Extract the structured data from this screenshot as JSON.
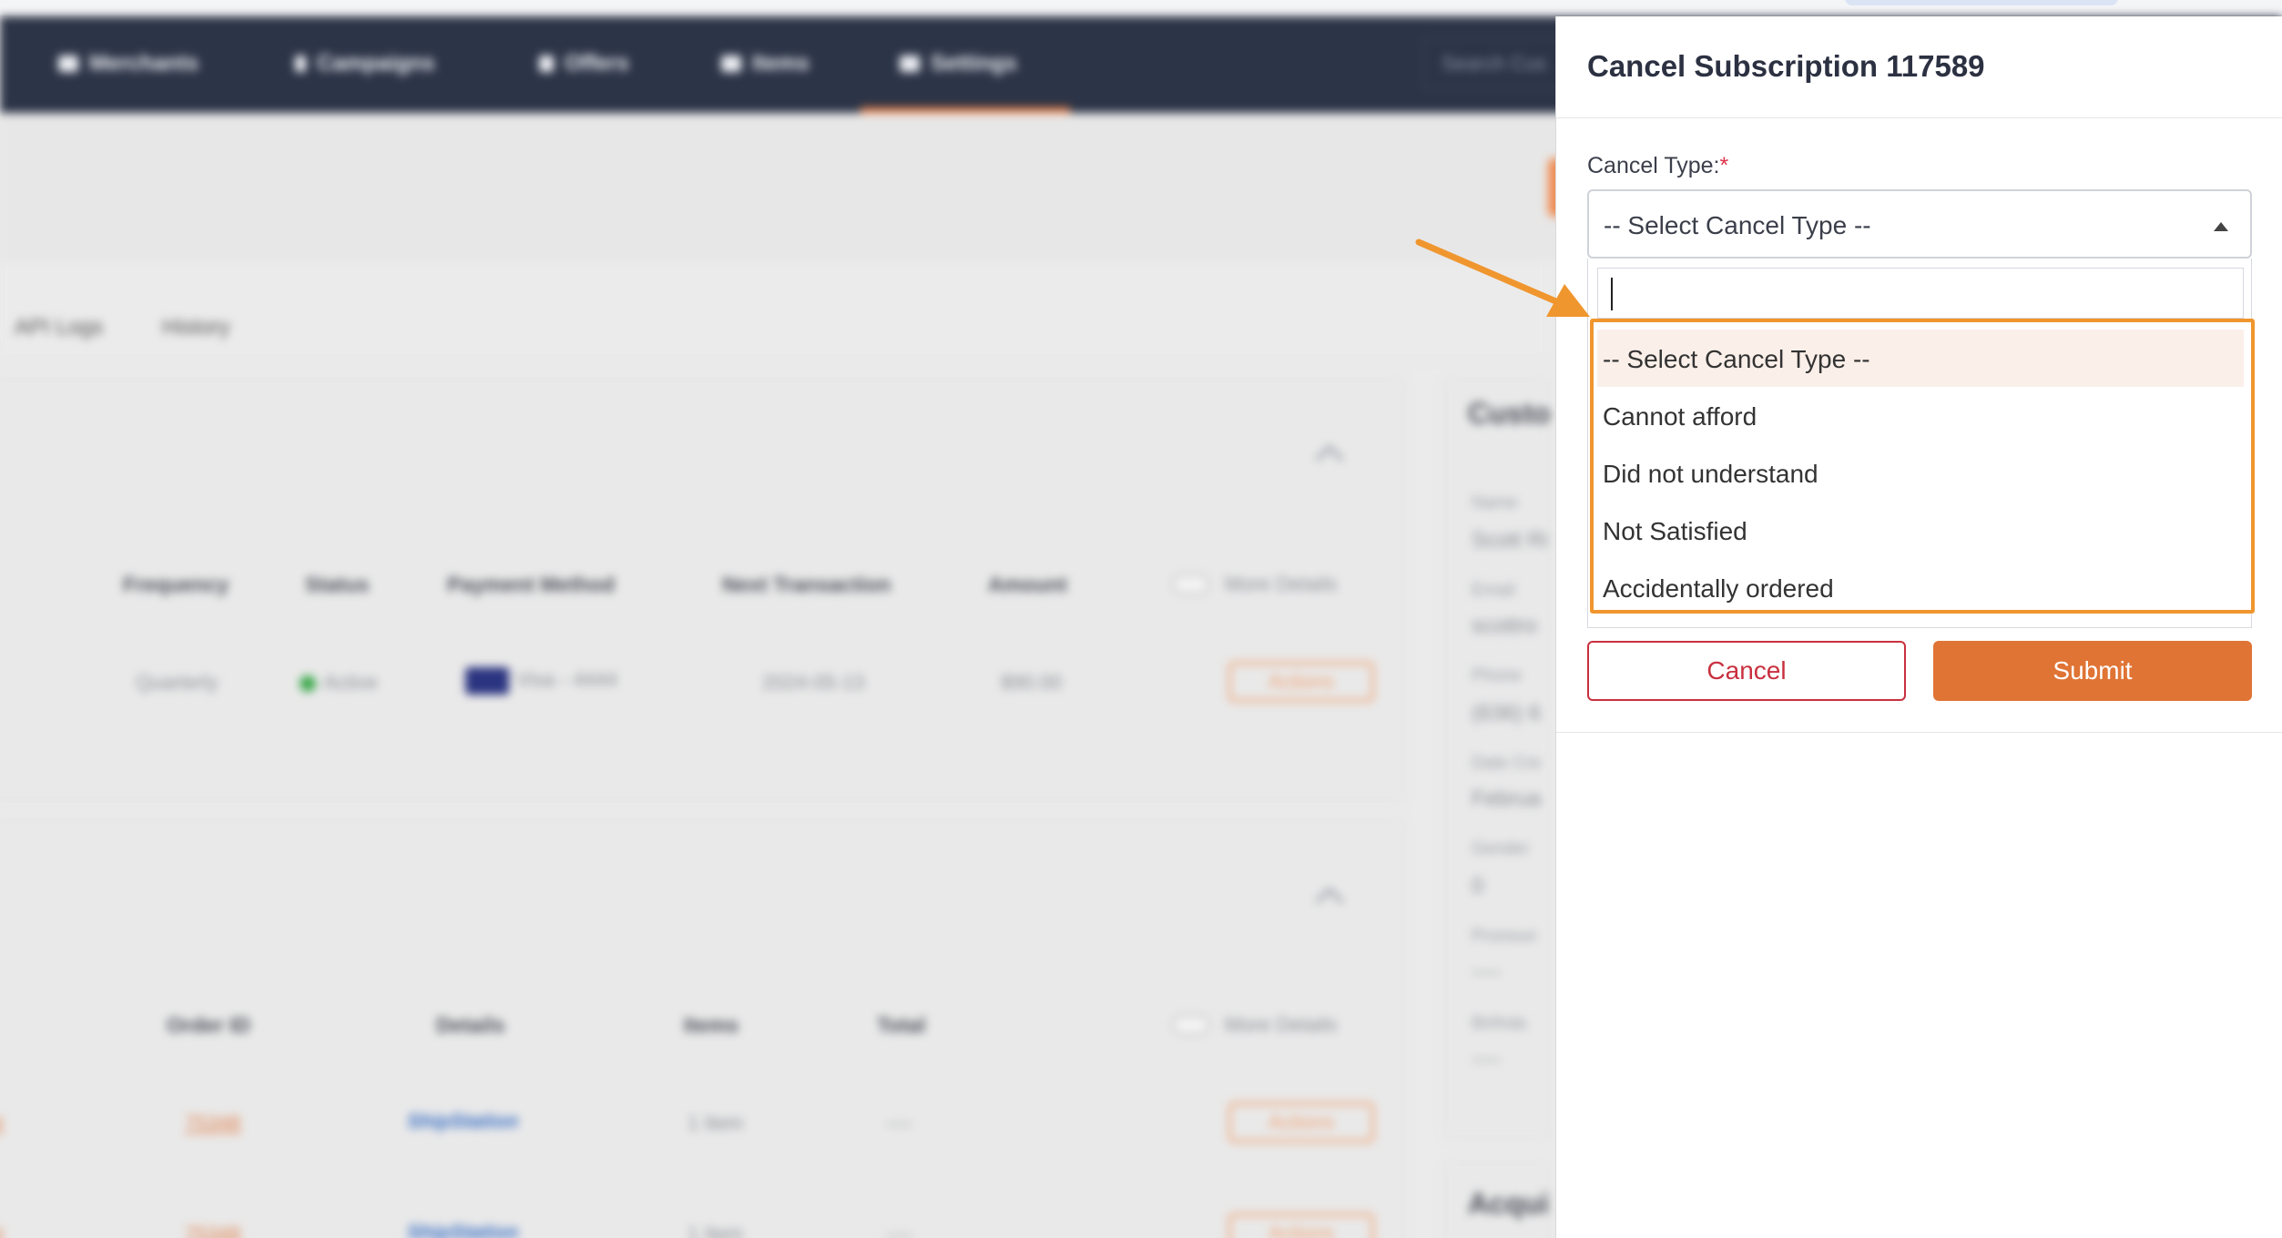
{
  "nav": {
    "items": [
      {
        "label": "Merchants",
        "icon": "briefcase-icon"
      },
      {
        "label": "Campaigns",
        "icon": "megaphone-icon"
      },
      {
        "label": "Offers",
        "icon": "tag-icon"
      },
      {
        "label": "Items",
        "icon": "box-icon"
      },
      {
        "label": "Settings",
        "icon": "wrench-icon"
      }
    ],
    "active": "Settings",
    "search_placeholder": "Search Cus"
  },
  "tabs": [
    "API Logs",
    "History"
  ],
  "subscriptions": {
    "headers": [
      "Frequency",
      "Status",
      "Payment Method",
      "Next Transaction",
      "Amount"
    ],
    "toggle_label": "More Details",
    "row": {
      "frequency": "Quarterly",
      "status": "Active",
      "payment": "Visa - 4444",
      "next": "2024-05-13",
      "amount": "$90.00",
      "actions": "Actions"
    }
  },
  "orders": {
    "headers": [
      "Order ID",
      "Details",
      "Items",
      "Total"
    ],
    "toggle_label": "More Details",
    "rows": [
      {
        "prefix": "nt",
        "order_id": "75348",
        "details": "ShipStation",
        "items": "1 Item",
        "total": "----",
        "actions": "Actions"
      },
      {
        "prefix": "nt",
        "order_id": "75348",
        "details": "ShipStation",
        "items": "1 Item",
        "total": "----",
        "actions": "Actions"
      }
    ]
  },
  "customer": {
    "title": "Custo",
    "fields": [
      {
        "label": "Name",
        "value": "Scott Ri"
      },
      {
        "label": "Email",
        "value": "scottro"
      },
      {
        "label": "Phone",
        "value": "(636) 6"
      },
      {
        "label": "Date Cre",
        "value": "Februa"
      },
      {
        "label": "Gender",
        "value": "0"
      },
      {
        "label": "Pronoun",
        "value": "----"
      },
      {
        "label": "Birthda",
        "value": "----"
      }
    ],
    "acq_title": "Acqui"
  },
  "modal": {
    "title": "Cancel Subscription 117589",
    "field_label": "Cancel Type:",
    "required_mark": "*",
    "selected": "-- Select Cancel Type --",
    "options": [
      "-- Select Cancel Type --",
      "Cannot afford",
      "Did not understand",
      "Not Satisfied",
      "Accidentally ordered"
    ],
    "cancel_label": "Cancel",
    "submit_label": "Submit"
  },
  "colors": {
    "accent": "#e07435",
    "annotation": "#f0962e",
    "danger": "#c9303e",
    "navbar": "#2c3447"
  }
}
